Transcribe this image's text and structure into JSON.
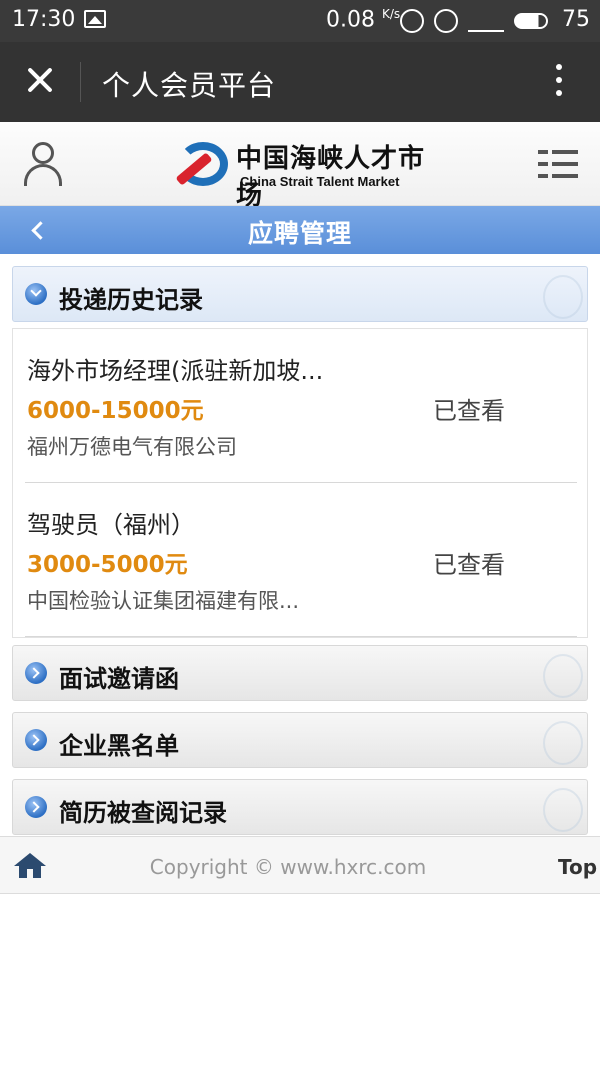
{
  "status_bar": {
    "time": "17:30",
    "net_speed": "0.08",
    "net_unit": "K/s",
    "battery": "75"
  },
  "appbar": {
    "title": "个人会员平台"
  },
  "site": {
    "logo_cn": "中国海峡人才市场",
    "logo_en": "China Strait Talent Market"
  },
  "page": {
    "title": "应聘管理"
  },
  "sections": [
    {
      "label": "投递历史记录"
    },
    {
      "label": "面试邀请函"
    },
    {
      "label": "企业黑名单"
    },
    {
      "label": "简历被查阅记录"
    }
  ],
  "applications": [
    {
      "job": "海外市场经理(派驻新加坡...",
      "salary": "6000-15000元",
      "status": "已查看",
      "company": "福州万德电气有限公司"
    },
    {
      "job": "驾驶员（福州）",
      "salary": "3000-5000元",
      "status": "已查看",
      "company": "中国检验认证集团福建有限..."
    }
  ],
  "footer": {
    "copyright": "Copyright © www.hxrc.com",
    "top": "Top"
  },
  "colors": {
    "accent_bar": "#5a8fd9",
    "salary": "#e08a10",
    "logo_blue": "#1f6fb8",
    "logo_red": "#d9232d"
  }
}
